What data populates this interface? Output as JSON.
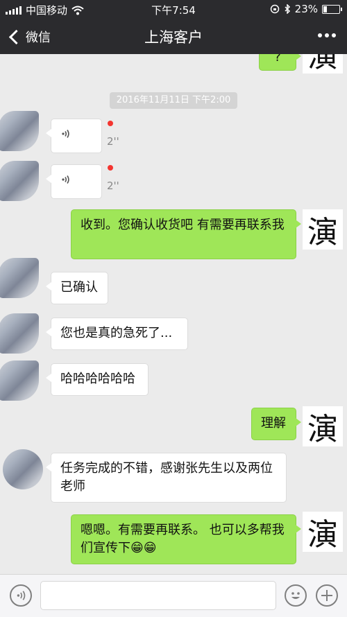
{
  "status_bar": {
    "carrier": "中国移动",
    "time": "下午7:54",
    "battery_percent": "23%",
    "battery_level": 0.23
  },
  "nav": {
    "back_label": "微信",
    "title": "上海客户"
  },
  "avatars": {
    "me_glyph": "演"
  },
  "chat": {
    "partial_top_text": "?",
    "timestamp": "2016年11月11日 下午2:00",
    "voice1_duration": "2''",
    "voice2_duration": "2''",
    "msg1": "收到。您确认收货吧 有需要再联系我",
    "msg2": "已确认",
    "msg3": "您也是真的急死了...",
    "msg4": "哈哈哈哈哈哈",
    "msg5": "理解",
    "msg6": "任务完成的不错，感谢张先生以及两位老师",
    "msg7": "嗯嗯。有需要再联系。 也可以多帮我们宣传下😁😁"
  },
  "colors": {
    "green_bubble": "#9fe658",
    "header_bg": "#2b2b2e",
    "chat_bg": "#ebebeb"
  },
  "icons": [
    "signal-icon",
    "wifi-icon",
    "lock-rotation-icon",
    "bluetooth-icon",
    "battery-icon",
    "chevron-left-icon",
    "more-icon",
    "voice-icon",
    "emoji-icon",
    "plus-icon"
  ]
}
